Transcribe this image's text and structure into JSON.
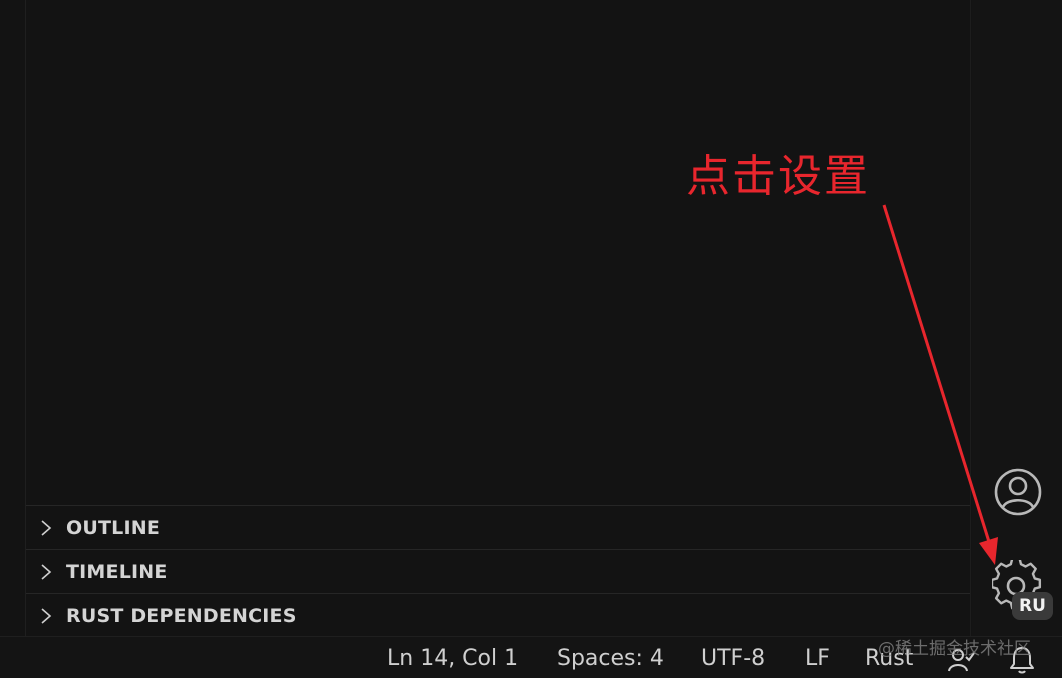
{
  "sidebar": {
    "panels": [
      {
        "label": "OUTLINE"
      },
      {
        "label": "TIMELINE"
      },
      {
        "label": "RUST DEPENDENCIES"
      }
    ]
  },
  "activity_bar": {
    "profile_badge": "RU",
    "icons": [
      "account-icon",
      "gear-icon"
    ]
  },
  "status_bar": {
    "cursor_position": "Ln 14, Col 1",
    "indentation": "Spaces: 4",
    "encoding": "UTF-8",
    "line_ending": "LF",
    "language": "Rust",
    "icons": [
      "feedback-person-icon",
      "bell-icon"
    ]
  },
  "annotation": {
    "text": "点击设置",
    "color": "#e8262d"
  },
  "watermark": "@稀土掘金技术社区",
  "colors": {
    "background": "#141414",
    "text": "#cccccc",
    "badge_bg": "#3a3a3a",
    "annotation_red": "#e8262d"
  }
}
